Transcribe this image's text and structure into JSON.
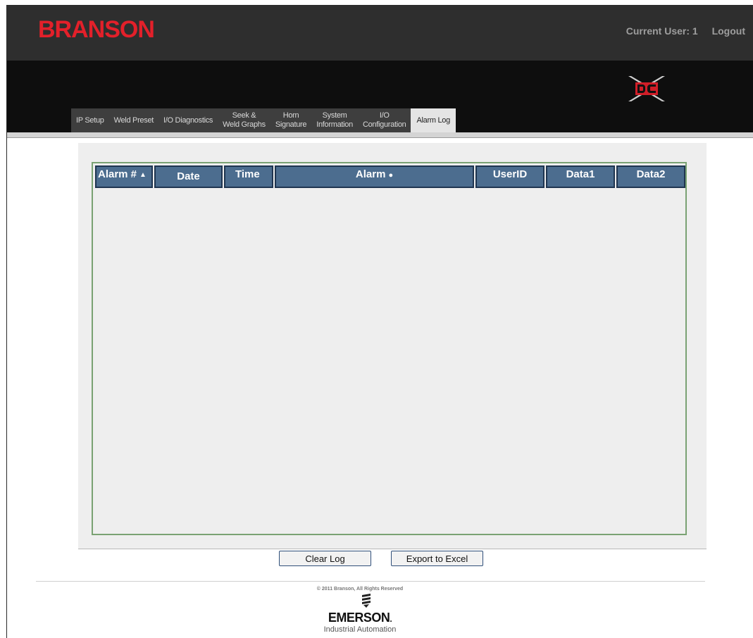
{
  "header": {
    "brand": "BRANSON",
    "current_user": "Current User: 1",
    "logout": "Logout",
    "product_logo_icon": "dcx-logo-icon"
  },
  "tabs": [
    {
      "label": "IP Setup"
    },
    {
      "label": "Weld Preset"
    },
    {
      "label": "I/O Diagnostics"
    },
    {
      "label": "Seek &\nWeld Graphs"
    },
    {
      "label": "Horn\nSignature"
    },
    {
      "label": "System\nInformation"
    },
    {
      "label": "I/O\nConfiguration"
    },
    {
      "label": "Alarm Log",
      "active": true
    }
  ],
  "alarm_log": {
    "columns": [
      {
        "label": "Alarm #",
        "icon": "sort-asc-icon"
      },
      {
        "label": "Date"
      },
      {
        "label": "Time"
      },
      {
        "label": "Alarm",
        "icon": "dot-icon"
      },
      {
        "label": "UserID"
      },
      {
        "label": "Data1"
      },
      {
        "label": "Data2"
      }
    ],
    "rows": []
  },
  "actions": {
    "clear_log": "Clear Log",
    "export": "Export to Excel"
  },
  "footer": {
    "copyright": "© 2011 Branson, All Rights Reserved",
    "company": "EMERSON",
    "company_suffix": ".",
    "division": "Industrial Automation",
    "logo_icon": "emerson-logo-icon"
  },
  "colors": {
    "brand_red": "#e3202a",
    "header_dark": "#2e2e2e",
    "nav_black": "#0e0e0e",
    "column_header_blue": "#4c6d8f",
    "log_border_green": "#7aa273"
  }
}
